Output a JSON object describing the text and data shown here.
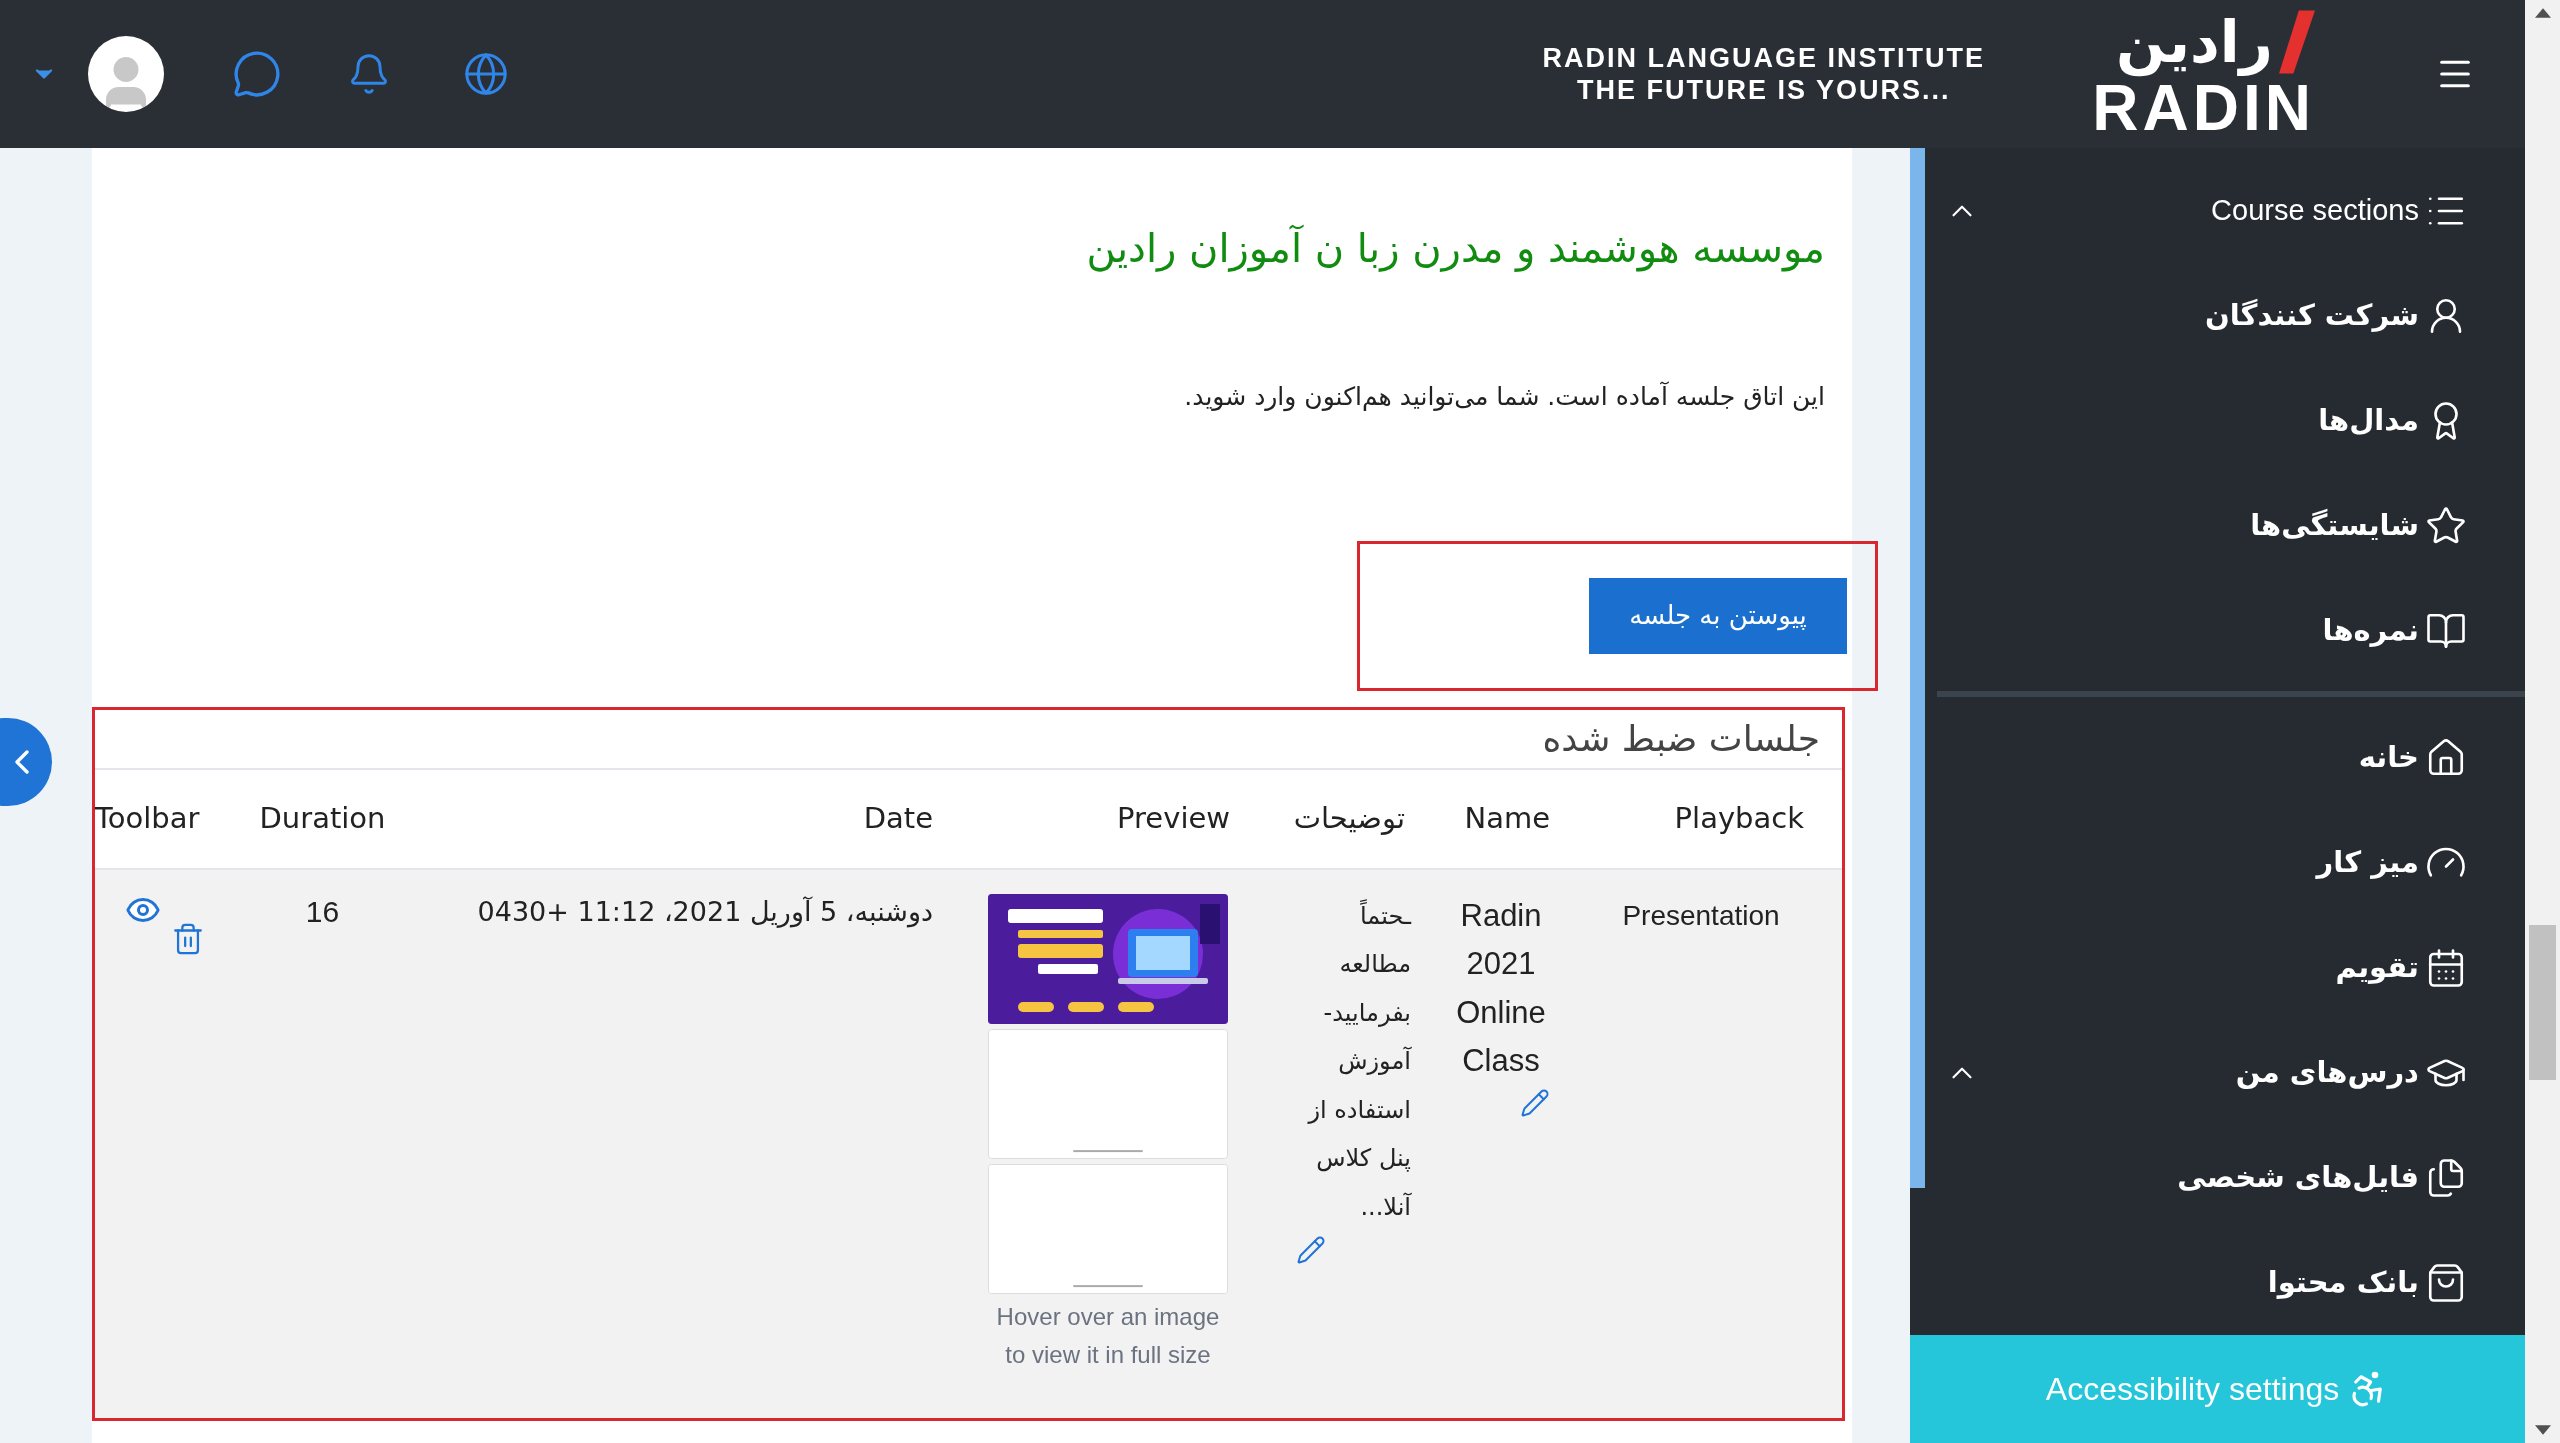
{
  "header": {
    "brand_line_1": "RADIN LANGUAGE INSTITUTE",
    "brand_line_2": "THE FUTURE IS YOURS...",
    "logo_persian": "رادین",
    "logo_latin": "RADIN"
  },
  "content": {
    "heading": "موسسه هوشمند و مدرن زبا ن آموزان رادین",
    "message": "این اتاق جلسه آماده است.  شما می‌توانید هم‌اکنون وارد شوید.",
    "join_button": "پیوستن به جلسه"
  },
  "recordings": {
    "title": "جلسات ضبط شده",
    "columns": [
      "Playback",
      "Name",
      "توضیحات",
      "Preview",
      "Date",
      "Duration",
      "Toolbar"
    ],
    "rows": [
      {
        "playback": "Presentation",
        "name": "Radin 2021 Online Class",
        "description": "ـحتماً مطالعه بفرمایید- آموزش استفاده از پنل کلاس آنلا...",
        "preview_caption": "Hover over an image to view it in full size",
        "date": "دوشنبه، 5 آوریل 2021، 11:12 +0430",
        "duration": "16"
      }
    ]
  },
  "sidebar": {
    "groups": [
      {
        "items": [
          {
            "label": "Course sections",
            "kind": "collapsible",
            "expanded": true
          },
          {
            "label": "شرکت کنندگان",
            "kind": "link"
          },
          {
            "label": "مدال‌ها",
            "kind": "link"
          },
          {
            "label": "شایستگی‌ها",
            "kind": "link"
          },
          {
            "label": "نمره‌ها",
            "kind": "link"
          }
        ]
      },
      {
        "items": [
          {
            "label": "خانه",
            "kind": "link"
          },
          {
            "label": "میز کار",
            "kind": "link"
          },
          {
            "label": "تقویم",
            "kind": "link"
          },
          {
            "label": "درس‌های من",
            "kind": "collapsible",
            "expanded": true
          },
          {
            "label": "فایل‌های شخصی",
            "kind": "link"
          },
          {
            "label": "بانک محتوا",
            "kind": "link"
          }
        ]
      }
    ]
  },
  "accessibility": {
    "label": "Accessibility settings"
  }
}
